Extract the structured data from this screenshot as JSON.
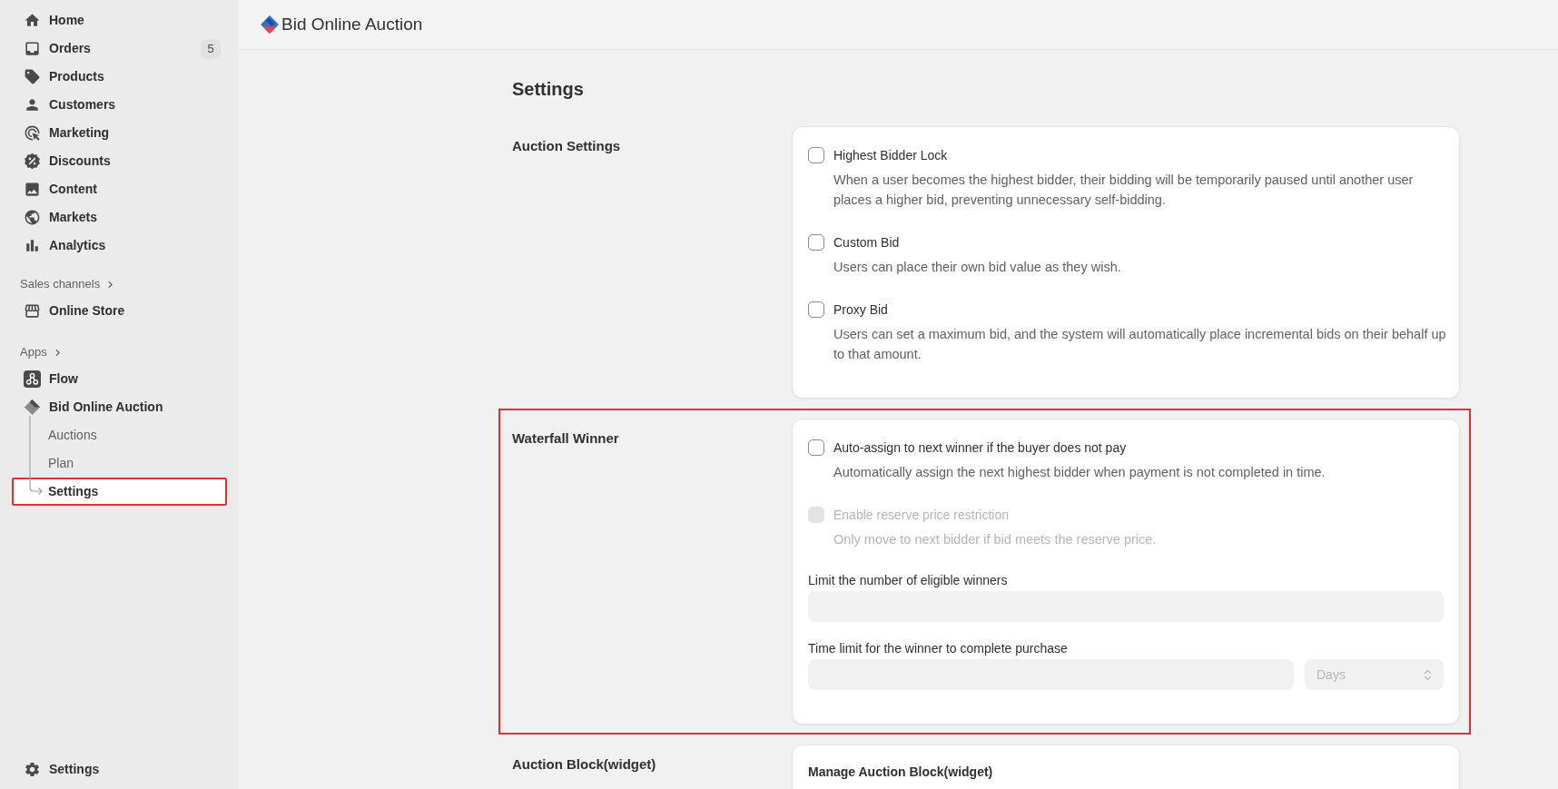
{
  "sidebar": {
    "nav": [
      {
        "label": "Home",
        "selected": false
      },
      {
        "label": "Orders",
        "badge": "5",
        "selected": false
      },
      {
        "label": "Products",
        "selected": false
      },
      {
        "label": "Customers",
        "selected": false
      },
      {
        "label": "Marketing",
        "selected": false
      },
      {
        "label": "Discounts",
        "selected": false
      },
      {
        "label": "Content",
        "selected": false
      },
      {
        "label": "Markets",
        "selected": false
      },
      {
        "label": "Analytics",
        "selected": false
      }
    ],
    "sales_channels": {
      "heading": "Sales channels",
      "items": [
        {
          "label": "Online Store",
          "selected": false
        }
      ]
    },
    "apps": {
      "heading": "Apps",
      "items": [
        {
          "label": "Flow",
          "selected": false
        },
        {
          "label": "Bid Online Auction",
          "selected": false,
          "children": [
            {
              "label": "Auctions",
              "selected": false,
              "highlighted": false
            },
            {
              "label": "Plan",
              "selected": false,
              "highlighted": false
            },
            {
              "label": "Settings",
              "selected": true,
              "highlighted": true
            }
          ]
        }
      ]
    },
    "footer": {
      "label": "Settings",
      "selected": false
    }
  },
  "header": {
    "title": "Bid Online Auction"
  },
  "page": {
    "title": "Settings",
    "sections": [
      {
        "title": "Auction Settings",
        "highlighted": false,
        "items": [
          {
            "kind": "checkbox",
            "label": "Highest Bidder Lock",
            "description": "When a user becomes the highest bidder, their bidding will be temporarily paused until another user places a higher bid, preventing unnecessary self-bidding.",
            "checked": false,
            "disabled": false
          },
          {
            "kind": "checkbox",
            "label": "Custom Bid",
            "description": "Users can place their own bid value as they wish.",
            "checked": false,
            "disabled": false
          },
          {
            "kind": "checkbox",
            "label": "Proxy Bid",
            "description": "Users can set a maximum bid, and the system will automatically place incremental bids on their behalf up to that amount.",
            "checked": false,
            "disabled": false
          }
        ]
      },
      {
        "title": "Waterfall Winner",
        "highlighted": true,
        "items": [
          {
            "kind": "checkbox",
            "label": "Auto-assign to next winner if the buyer does not pay",
            "description": "Automatically assign the next highest bidder when payment is not completed in time.",
            "checked": false,
            "disabled": false
          },
          {
            "kind": "checkbox",
            "label": "Enable reserve price restriction",
            "description": "Only move to next bidder if bid meets the reserve price.",
            "checked": false,
            "disabled": true
          },
          {
            "kind": "text_field",
            "label": "Limit the number of eligible winners",
            "disabled": true
          },
          {
            "kind": "duration_field",
            "label": "Time limit for the winner to complete purchase",
            "unit": "Days",
            "disabled": true
          }
        ]
      },
      {
        "title": "Auction Block(widget)",
        "highlighted": false,
        "items": [
          {
            "kind": "heading",
            "text": "Manage Auction Block(widget)"
          }
        ]
      }
    ]
  }
}
